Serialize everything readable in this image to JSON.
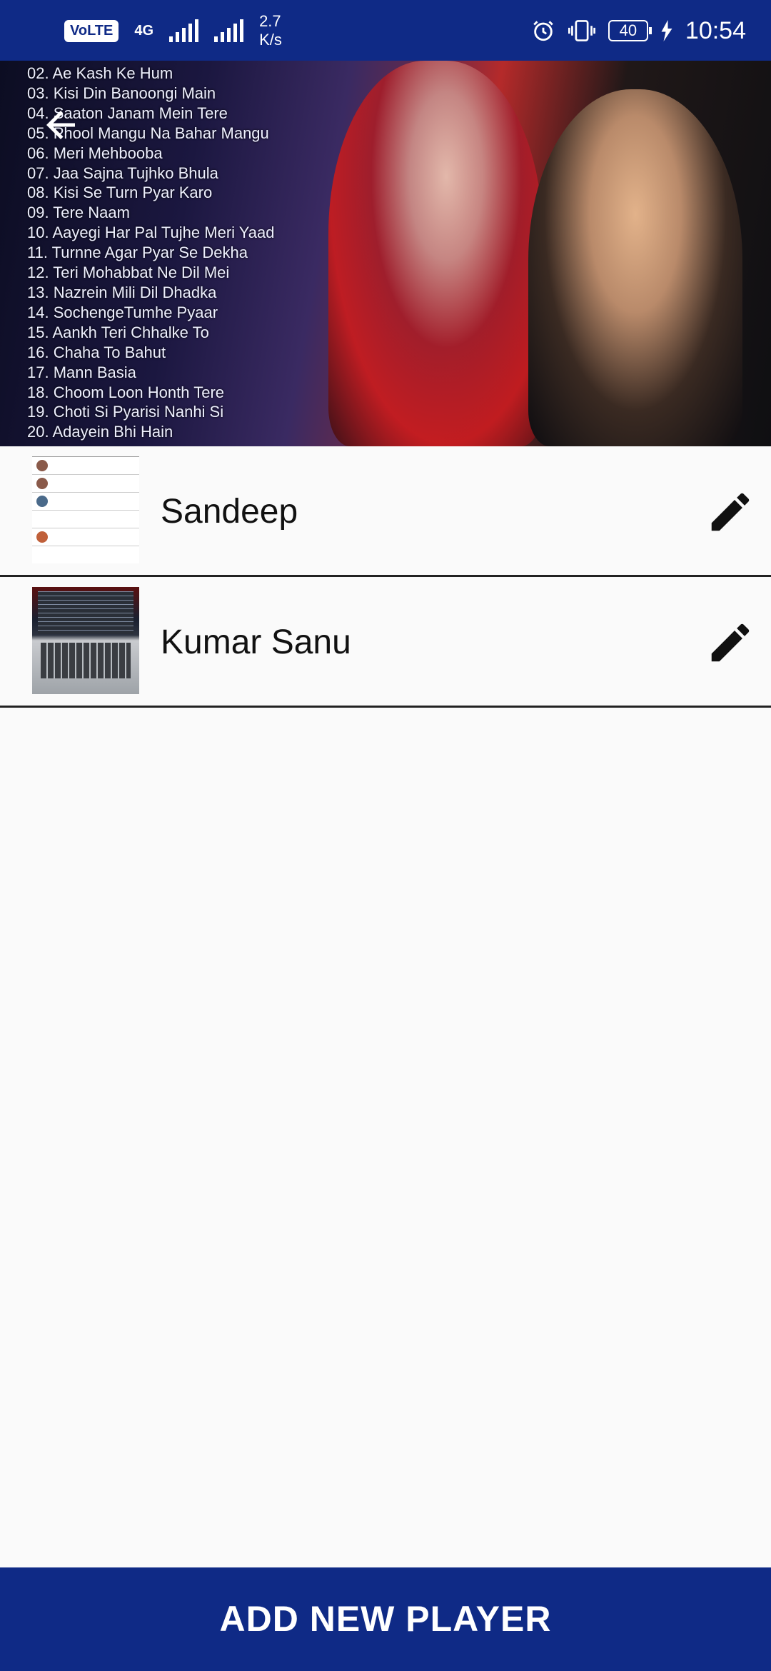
{
  "status_bar": {
    "volte": "VoLTE",
    "network": "4G",
    "speed_value": "2.7",
    "speed_unit": "K/s",
    "battery": "40",
    "time": "10:54"
  },
  "hero": {
    "songs": [
      "02. Ae Kash Ke Hum",
      "03. Kisi Din Banoongi Main",
      "04. Saaton Janam Mein Tere",
      "05. Phool Mangu Na Bahar Mangu",
      "06. Meri Mehbooba",
      "07. Jaa Sajna Tujhko Bhula",
      "08. Kisi Se Turn Pyar Karo",
      "09. Tere Naam",
      "10. Aayegi Har Pal Tujhe Meri Yaad",
      "11. Turnne Agar Pyar Se Dekha",
      "12. Teri Mohabbat Ne Dil Mei",
      "13. Nazrein Mili Dil Dhadka",
      "14. SochengeTumhe Pyaar",
      "15. Aankh Teri Chhalke To",
      "16. Chaha To Bahut",
      "17. Mann Basia",
      "18. Choom Loon Honth Tere",
      "19. Choti Si Pyarisi Nanhi Si",
      "20. Adayein Bhi Hain"
    ]
  },
  "players": [
    {
      "name": "Sandeep"
    },
    {
      "name": "Kumar Sanu"
    }
  ],
  "add_button_label": "ADD NEW PLAYER",
  "icons": {
    "back": "arrow-left-icon",
    "edit": "pencil-icon"
  },
  "colors": {
    "primary": "#0f2a86",
    "background": "#fafafa",
    "divider": "#222222"
  }
}
